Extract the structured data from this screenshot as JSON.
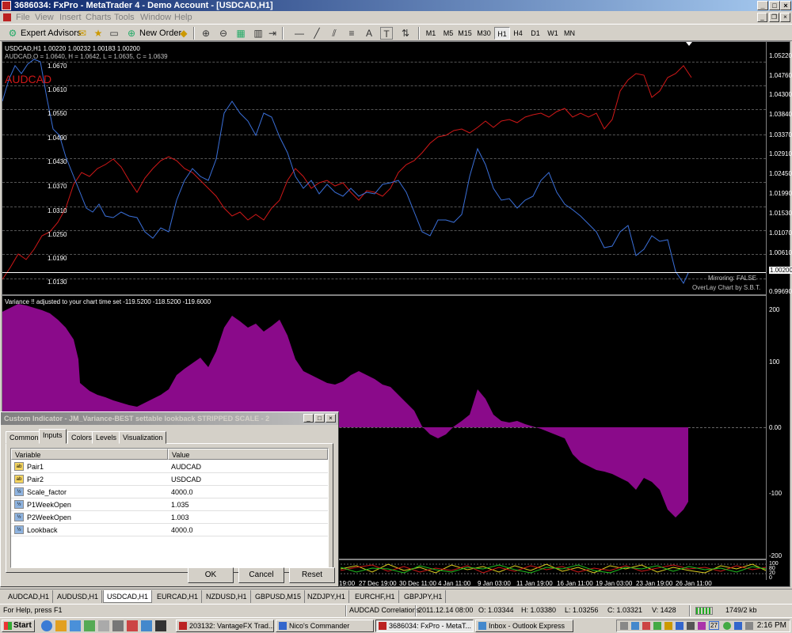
{
  "window": {
    "title": "3686034: FxPro - MetaTrader 4 - Demo Account - [USDCAD,H1]"
  },
  "menu": [
    "File",
    "View",
    "Insert",
    "Charts",
    "Tools",
    "Window",
    "Help"
  ],
  "toolbar": {
    "expert_advisors": "Expert Advisors",
    "new_order": "New Order",
    "text_tool": "A",
    "label_tool": "T",
    "timeframes": [
      "M1",
      "M5",
      "M15",
      "M30",
      "H1",
      "H4",
      "D1",
      "W1",
      "MN"
    ],
    "active_timeframe": "H1"
  },
  "chart": {
    "header_line1": "USDCAD,H1  1.00220 1.00232 1.00183 1.00200",
    "header_line2": "AUDCAD,O = 1.0640, H = 1.0642, L = 1.0635, C = 1.0639",
    "overlay_symbol": "AUDCAD",
    "overlay_levels": [
      "1.0670",
      "1.0610",
      "1.0550",
      "1.0490",
      "1.0430",
      "1.0370",
      "1.0310",
      "1.0250",
      "1.0190",
      "1.0130"
    ],
    "price_axis": [
      "1.05220",
      "1.04760",
      "1.04300",
      "1.03840",
      "1.03370",
      "1.02910",
      "1.02450",
      "1.01990",
      "1.01530",
      "1.01070",
      "1.00610",
      "1.00200",
      "0.99690"
    ],
    "current_price": "1.00200",
    "mirroring_label": "Mirroring: FALSE",
    "overlay_label": "OverLay Chart by S.B.T.",
    "colors": {
      "usdcad": "#3a6fd8",
      "audcad": "#d01818",
      "variance": "#8a0a8a",
      "background": "#000000"
    }
  },
  "indicator": {
    "label": "Variance !! adjusted to your chart time set -119.5200 -118.5200 -119.6000",
    "axis": [
      "200",
      "100",
      "0.00",
      "-100",
      "-200"
    ]
  },
  "lower_pane": {
    "axis": [
      "100",
      "80",
      "20",
      "0"
    ]
  },
  "time_axis": [
    "19:00",
    "27 Dec 19:00",
    "30 Dec 11:00",
    "4 Jan 11:00",
    "9 Jan 03:00",
    "11 Jan 19:00",
    "16 Jan 11:00",
    "19 Jan 03:00",
    "23 Jan 19:00",
    "26 Jan 11:00"
  ],
  "tabs": [
    "AUDCAD,H1",
    "AUDUSD,H1",
    "USDCAD,H1",
    "EURCAD,H1",
    "NZDUSD,H1",
    "GBPUSD,M15",
    "NZDJPY,H1",
    "EURCHF,H1",
    "GBPJPY,H1"
  ],
  "active_tab": "USDCAD,H1",
  "status": {
    "help": "For Help, press F1",
    "profile": "AUDCAD Correlations",
    "datetime": "2011.12.14 08:00",
    "open": "O: 1.03344",
    "high": "H: 1.03380",
    "low": "L: 1.03256",
    "close": "C: 1.03321",
    "volume": "V: 1428",
    "traffic": "1749/2 kb"
  },
  "taskbar": {
    "start": "Start",
    "tasks": [
      "203132: VantageFX Trad...",
      "Nico's Commander",
      "3686034: FxPro - MetaT...",
      "Inbox - Outlook Express"
    ],
    "clock": "2:16 PM",
    "tray_badge": "27"
  },
  "dialog": {
    "title": "Custom Indicator - JM_Variance-BEST settable lookback STRIPPED SCALE - 2",
    "tabs": [
      "Common",
      "Inputs",
      "Colors",
      "Levels",
      "Visualization"
    ],
    "active_tab": "Inputs",
    "columns": [
      "Variable",
      "Value"
    ],
    "rows": [
      {
        "type": "ab",
        "name": "Pair1",
        "value": "AUDCAD"
      },
      {
        "type": "ab",
        "name": "Pair2",
        "value": "USDCAD"
      },
      {
        "type": "num",
        "name": "Scale_factor",
        "value": "4000.0"
      },
      {
        "type": "num",
        "name": "P1WeekOpen",
        "value": "1.035"
      },
      {
        "type": "num",
        "name": "P2WeekOpen",
        "value": "1.003"
      },
      {
        "type": "num",
        "name": "Lookback",
        "value": "4000.0"
      }
    ],
    "buttons": {
      "ok": "OK",
      "cancel": "Cancel",
      "reset": "Reset"
    }
  }
}
